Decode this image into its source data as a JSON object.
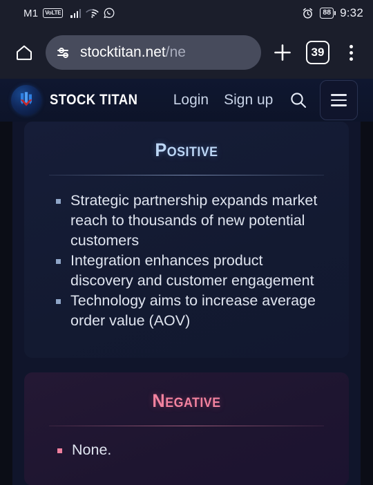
{
  "statusbar": {
    "carrier": "M1",
    "volte_badge": "VoLTE",
    "battery_level": "88",
    "time": "9:32",
    "icons": [
      "signal-bars-icon",
      "wifi-icon",
      "whatsapp-icon",
      "alarm-clock-icon",
      "battery-icon"
    ]
  },
  "browser": {
    "url_host": "stocktitan.net",
    "url_path": "/ne",
    "tab_count": "39",
    "home_icon": "home-icon",
    "site_settings_icon": "tune-icon",
    "new_tab_icon": "plus-icon",
    "overflow_icon": "three-dot-menu-icon"
  },
  "site_header": {
    "brand": "STOCK TITAN",
    "login_label": "Login",
    "signup_label": "Sign up",
    "search_icon": "search-icon",
    "menu_icon": "hamburger-menu-icon"
  },
  "content": {
    "positive": {
      "title": "Positive",
      "items": [
        "Strategic partnership expands market reach to thousands of new potential customers",
        "Integration enhances product discovery and customer engagement",
        "Technology aims to increase average order value (AOV)"
      ]
    },
    "negative": {
      "title": "Negative",
      "items": [
        "None."
      ]
    }
  },
  "colors": {
    "positive_accent": "#bcd6f5",
    "negative_accent": "#f2829f",
    "page_bg": "#10152b",
    "chrome_bg": "#1b1e2b"
  }
}
